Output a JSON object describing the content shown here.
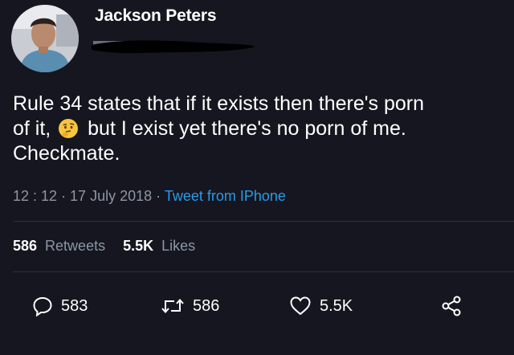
{
  "tweet": {
    "author_name": "Jackson Peters",
    "text_line1": "Rule 34 states that if it exists then there's porn",
    "text_line2_a": "of it,",
    "text_line2_b": "but I exist yet there's no porn of me.",
    "text_line3": "Checkmate.",
    "emoji": "thinking-face",
    "timestamp": "12 : 12 · 17 July 2018 ·",
    "source": "Tweet from IPhone"
  },
  "stats": {
    "retweets_count": "586",
    "retweets_label": "Retweets",
    "likes_count": "5.5K",
    "likes_label": "Likes"
  },
  "actions": {
    "reply_count": "583",
    "retweet_count": "586",
    "like_count": "5.5K",
    "icons": [
      "reply-icon",
      "retweet-icon",
      "heart-icon",
      "share-icon"
    ]
  },
  "colors": {
    "background": "#161620",
    "text": "#ffffff",
    "muted": "#8b97a4",
    "link": "#2b9ae6"
  }
}
